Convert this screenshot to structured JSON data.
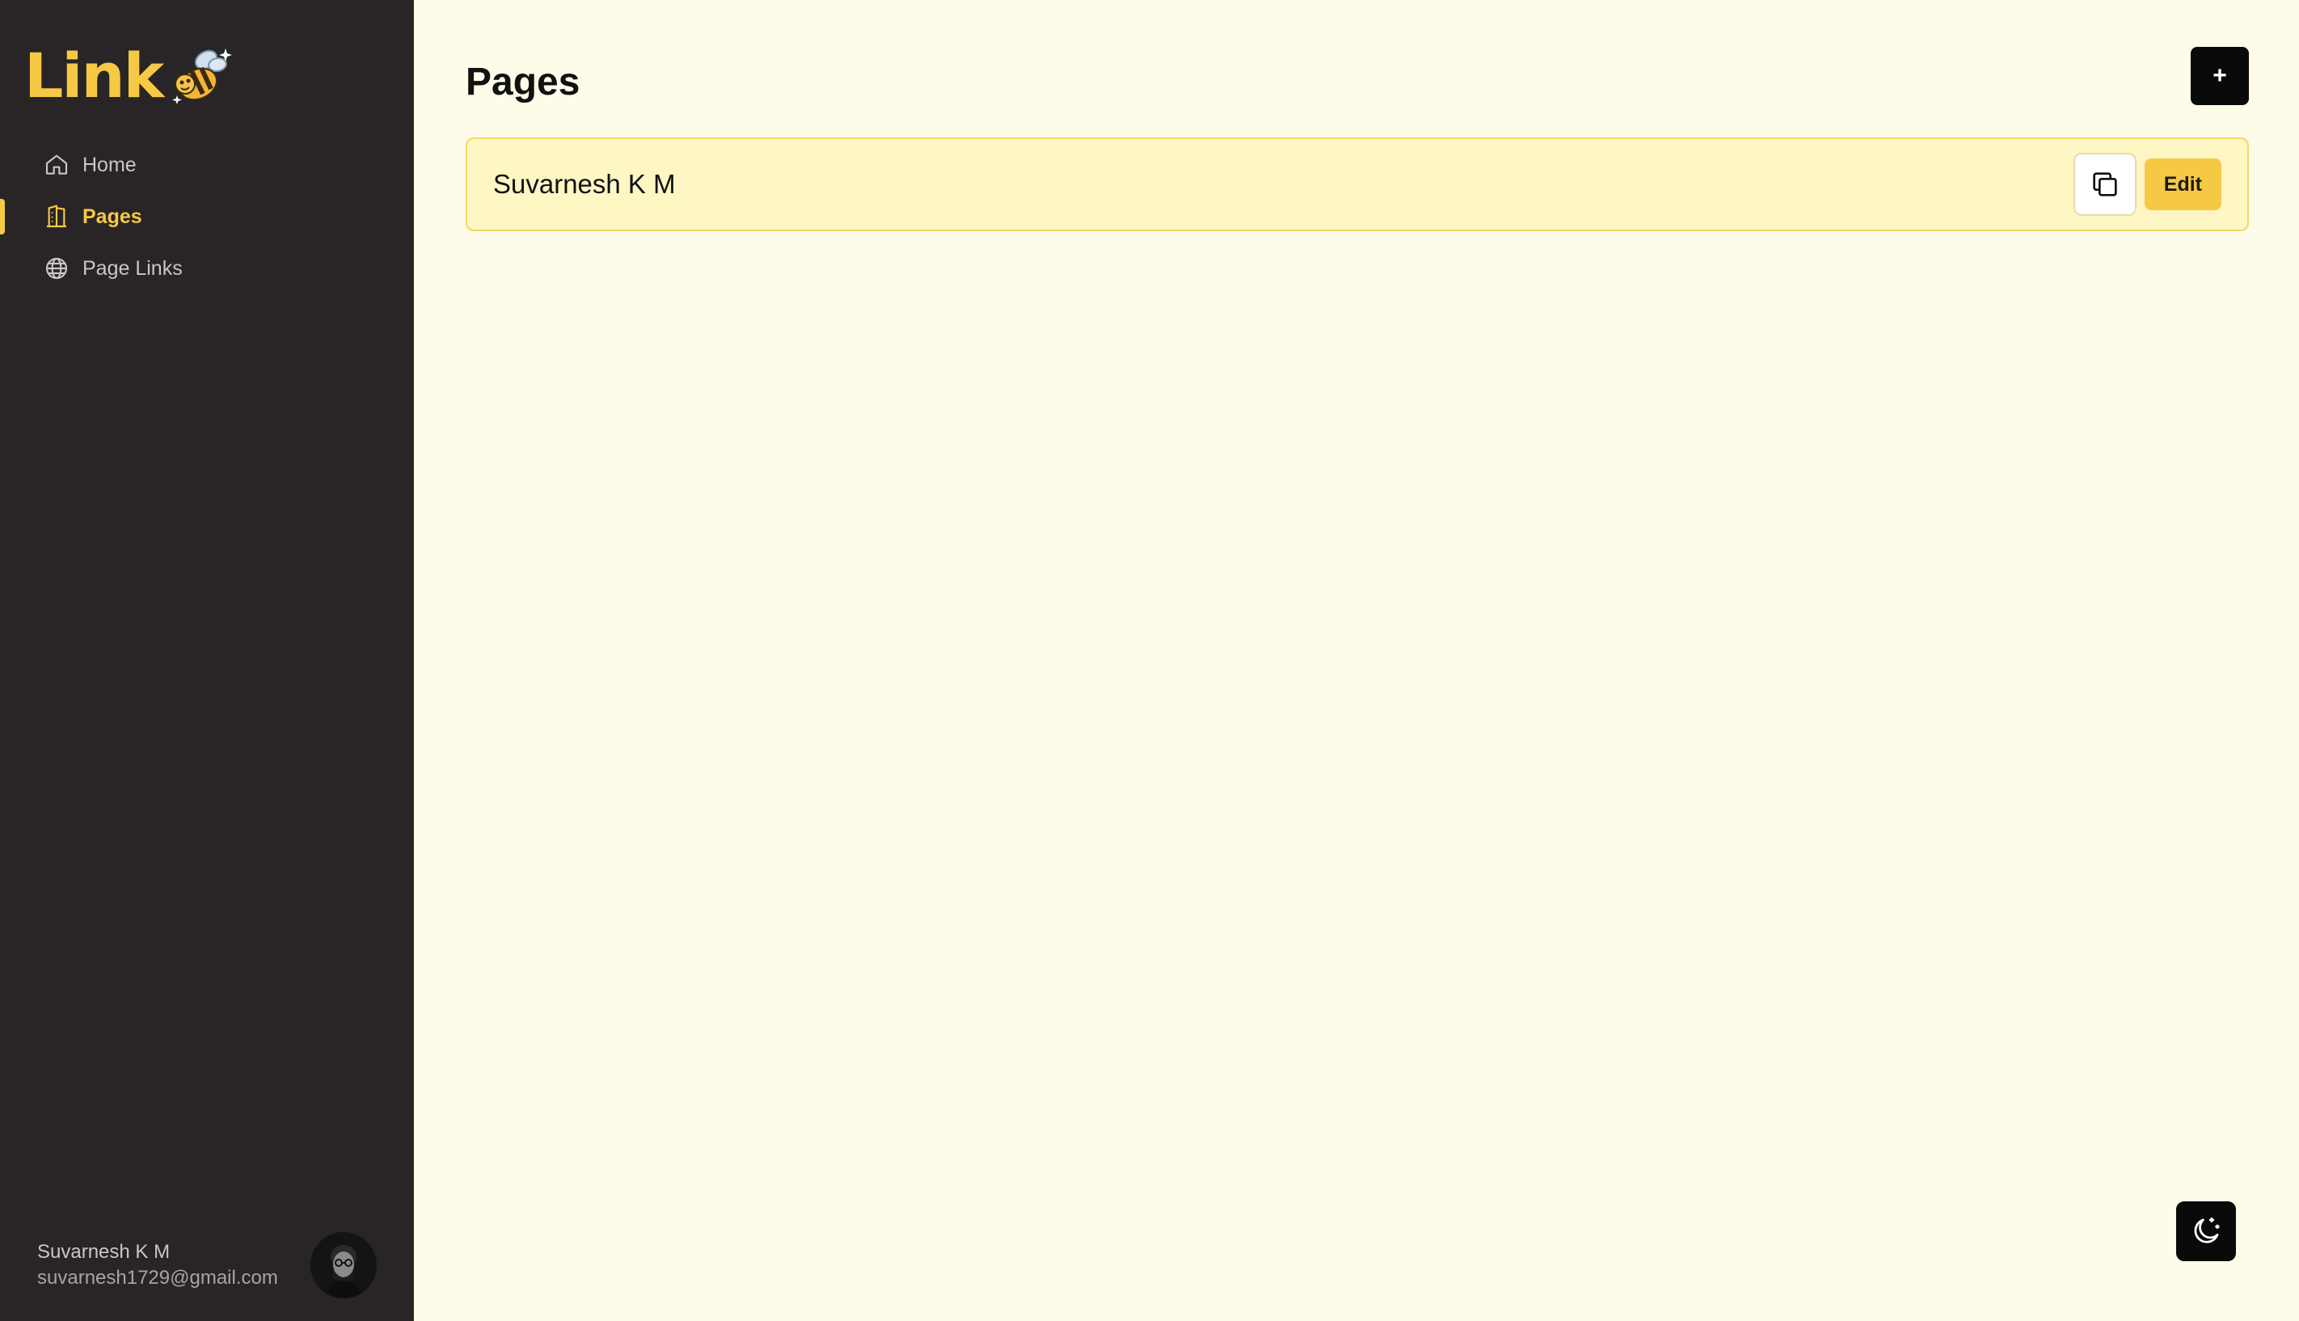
{
  "brand": {
    "name": "Link",
    "logo_icon": "bee-icon",
    "accent": "#f6c945"
  },
  "sidebar": {
    "items": [
      {
        "label": "Home",
        "icon": "home-icon",
        "active": false
      },
      {
        "label": "Pages",
        "icon": "pages-icon",
        "active": true
      },
      {
        "label": "Page Links",
        "icon": "globe-icon",
        "active": false
      }
    ],
    "user": {
      "name": "Suvarnesh K M",
      "email": "suvarnesh1729@gmail.com"
    }
  },
  "main": {
    "title": "Pages",
    "add_label": "+",
    "pages": [
      {
        "name": "Suvarnesh K M",
        "edit_label": "Edit",
        "copy_icon": "copy-icon"
      }
    ],
    "theme_toggle_icon": "moon-stars-icon"
  },
  "colors": {
    "sidebar_bg": "#292526",
    "main_bg": "#fefbe8",
    "card_bg": "#fef6c3",
    "card_border": "#f3d866"
  }
}
